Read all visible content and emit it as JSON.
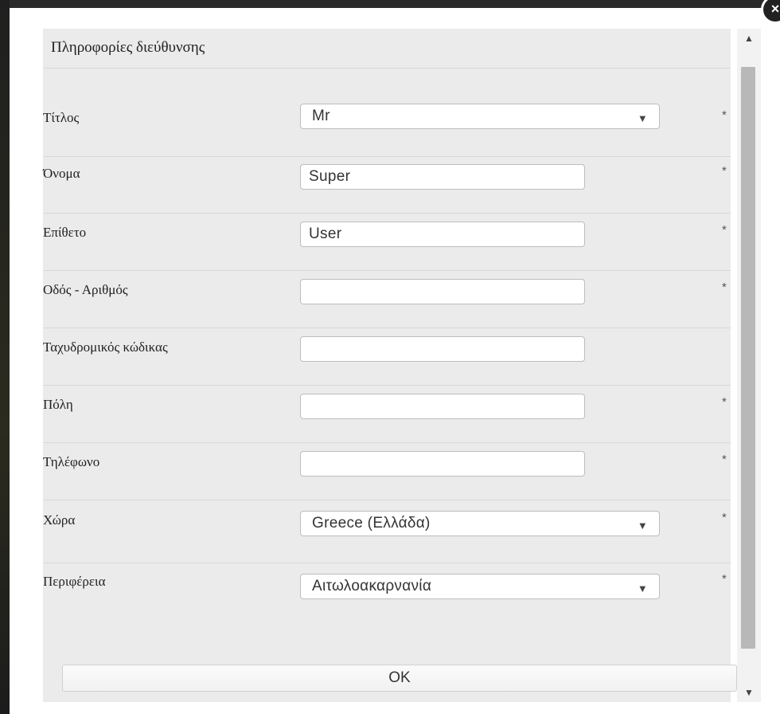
{
  "dialog": {
    "heading": "Πληροφορίες διεύθυνσης",
    "close_symbol": "×",
    "ok_label": "OK",
    "required_marker": "*"
  },
  "fields": {
    "title": {
      "label": "Τίτλος",
      "value": "Mr",
      "type": "select",
      "required": true
    },
    "first_name": {
      "label": "Όνομα",
      "value": "Super",
      "type": "text",
      "required": true
    },
    "last_name": {
      "label": "Επίθετο",
      "value": "User",
      "type": "text",
      "required": true
    },
    "street": {
      "label": "Οδός - Αριθμός",
      "value": "",
      "type": "text",
      "required": true
    },
    "postal_code": {
      "label": "Ταχυδρομικός κώδικας",
      "value": "",
      "type": "text",
      "required": false
    },
    "city": {
      "label": "Πόλη",
      "value": "",
      "type": "text",
      "required": true
    },
    "phone": {
      "label": "Τηλέφωνο",
      "value": "",
      "type": "text",
      "required": true
    },
    "country": {
      "label": "Χώρα",
      "value": "Greece (Ελλάδα)",
      "type": "select",
      "required": true
    },
    "region": {
      "label": "Περιφέρεια",
      "value": "Αιτωλοακαρνανία",
      "type": "select",
      "required": true
    }
  },
  "icons": {
    "select_arrow": "▼",
    "scroll_up": "▲",
    "scroll_down": "▼"
  }
}
